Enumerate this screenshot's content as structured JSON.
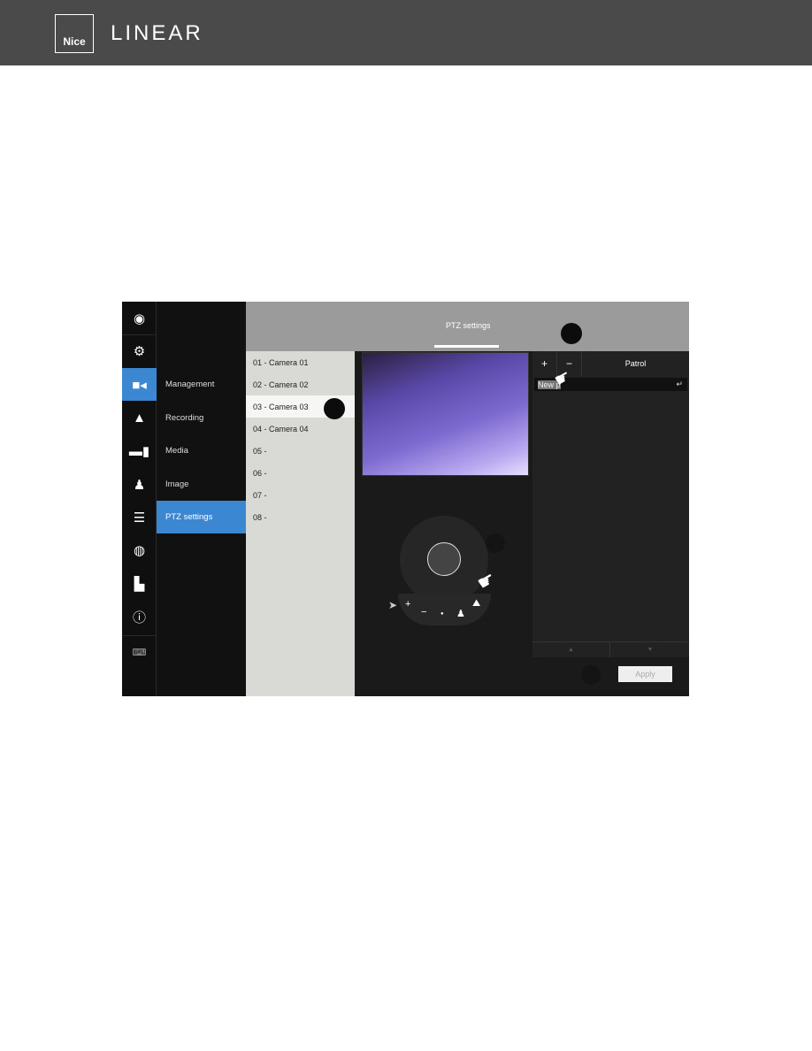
{
  "header": {
    "logo_box": "Nice",
    "logo_word": "LINEAR"
  },
  "app": {
    "icons": [
      "camera-view-icon",
      "gear-icon",
      "video-camera-icon",
      "bell-icon",
      "computer-icon",
      "user-icon",
      "database-icon",
      "network-icon",
      "plugin-icon",
      "info-icon",
      "keyboard-icon"
    ],
    "selected_icon": "video-camera-icon",
    "menu": [
      "Management",
      "Recording",
      "Media",
      "Image",
      "PTZ settings"
    ],
    "selected_menu": "PTZ settings",
    "tab_title": "PTZ settings",
    "cameras": [
      "01 - Camera 01",
      "02 - Camera 02",
      "03 - Camera 03",
      "04 - Camera 04",
      "05 -",
      "06 -",
      "07 -",
      "08 -"
    ],
    "selected_camera": "03 - Camera 03",
    "right_panel": {
      "add": "+",
      "remove": "−",
      "patrol": "Patrol",
      "preset_input": "New p",
      "enter": "↵",
      "up": "▲",
      "down": "▼"
    },
    "apply": "Apply",
    "controls": {
      "zoom_in": "+",
      "zoom_out": "−",
      "home": "●"
    },
    "accent": "#3c87d2"
  }
}
